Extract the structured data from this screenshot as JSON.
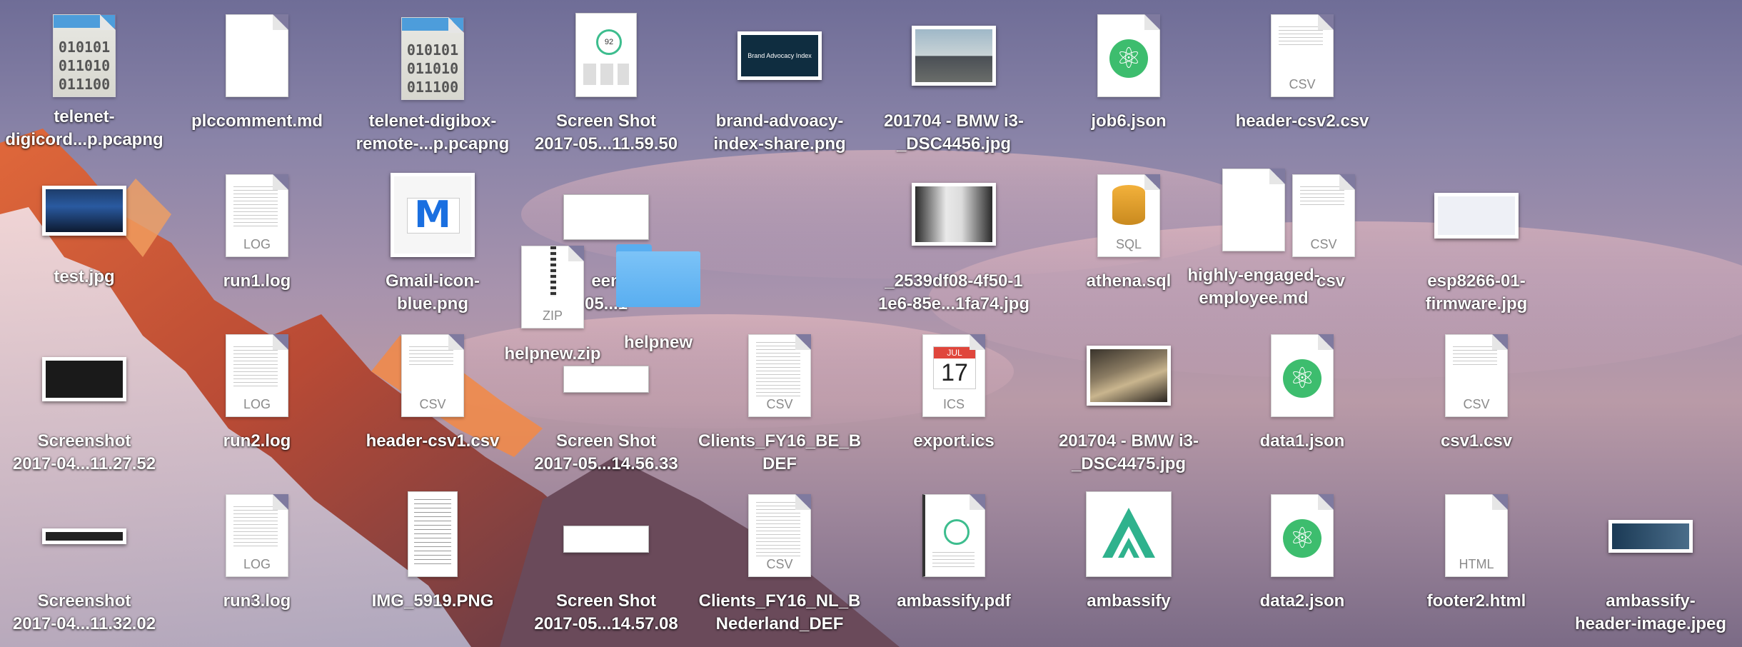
{
  "desktop_icons": [
    {
      "name": "telenet-digicord...p.pcapng",
      "lines": [
        "telenet-",
        "digicord...p.pcapng"
      ],
      "kind": "binary"
    },
    {
      "name": "plccomment.md",
      "lines": [
        "plccomment.md"
      ],
      "kind": "blank"
    },
    {
      "name": "telenet-digibox-remote-...p.pcapng",
      "lines": [
        "telenet-digibox-",
        "remote-...p.pcapng"
      ],
      "kind": "binary"
    },
    {
      "name": "Screen Shot 2017-05...11.59.50",
      "lines": [
        "Screen Shot",
        "2017-05...11.59.50"
      ],
      "kind": "screenshot"
    },
    {
      "name": "brand-advoacy-index-share.png",
      "lines": [
        "brand-advoacy-",
        "index-share.png"
      ],
      "kind": "image",
      "thumb_text": "Brand Advocacy Index"
    },
    {
      "name": "201704 - BMW i3-_DSC4456.jpg",
      "lines": [
        "201704 - BMW i3-",
        "_DSC4456.jpg"
      ],
      "kind": "photo"
    },
    {
      "name": "job6.json",
      "lines": [
        "job6.json"
      ],
      "kind": "json"
    },
    {
      "name": "header-csv2.csv",
      "lines": [
        "header-csv2.csv"
      ],
      "kind": "csv",
      "ext": "CSV"
    },
    {
      "name": "test.jpg",
      "lines": [
        "test.jpg"
      ],
      "kind": "photo"
    },
    {
      "name": "run1.log",
      "lines": [
        "run1.log"
      ],
      "kind": "log",
      "ext": "LOG"
    },
    {
      "name": "Gmail-icon-blue.png",
      "lines": [
        "Gmail-icon-",
        "blue.png"
      ],
      "kind": "gmail"
    },
    {
      "name": "Screen Shot 2017-05...",
      "lines": [
        "een",
        "05...1"
      ],
      "kind": "screenshot"
    },
    {
      "name": "helpnew.zip",
      "lines": [
        "helpnew.zip"
      ],
      "kind": "zip",
      "ext": "ZIP"
    },
    {
      "name": "helpnew",
      "lines": [
        "helpnew"
      ],
      "kind": "folder"
    },
    {
      "name": "_2539df08-4f50-11e6-85e...1fa74.jpg",
      "lines": [
        "_2539df08-4f50-1",
        "1e6-85e...1fa74.jpg"
      ],
      "kind": "photo"
    },
    {
      "name": "athena.sql",
      "lines": [
        "athena.sql"
      ],
      "kind": "sql",
      "ext": "SQL"
    },
    {
      "name": "highly-engaged-employee.md",
      "lines": [
        "highly-engaged-",
        "employee.md"
      ],
      "kind": "blank"
    },
    {
      "name": "e...csv",
      "lines": [
        "csv"
      ],
      "kind": "csv",
      "ext": "CSV"
    },
    {
      "name": "esp8266-01-firmware.jpg",
      "lines": [
        "esp8266-01-",
        "firmware.jpg"
      ],
      "kind": "image"
    },
    {
      "name": "Screenshot 2017-04...11.27.52",
      "lines": [
        "Screenshot",
        "2017-04...11.27.52"
      ],
      "kind": "screenshot"
    },
    {
      "name": "run2.log",
      "lines": [
        "run2.log"
      ],
      "kind": "log",
      "ext": "LOG"
    },
    {
      "name": "header-csv1.csv",
      "lines": [
        "header-csv1.csv"
      ],
      "kind": "csv",
      "ext": "CSV"
    },
    {
      "name": "Screen Shot 2017-05...14.56.33",
      "lines": [
        "Screen Shot",
        "2017-05...14.56.33"
      ],
      "kind": "screenshot"
    },
    {
      "name": "Clients_FY16_BE_BDEF",
      "lines": [
        "Clients_FY16_BE_B",
        "DEF"
      ],
      "kind": "csv",
      "ext": "CSV"
    },
    {
      "name": "export.ics",
      "lines": [
        "export.ics"
      ],
      "kind": "ics",
      "ext": "ICS",
      "month": "JUL",
      "day": "17"
    },
    {
      "name": "201704 - BMW i3-_DSC4475.jpg",
      "lines": [
        "201704 - BMW i3-",
        "_DSC4475.jpg"
      ],
      "kind": "photo"
    },
    {
      "name": "data1.json",
      "lines": [
        "data1.json"
      ],
      "kind": "json"
    },
    {
      "name": "csv1.csv",
      "lines": [
        "csv1.csv"
      ],
      "kind": "csv",
      "ext": "CSV"
    },
    {
      "name": "Screenshot 2017-04...11.32.02",
      "lines": [
        "Screenshot",
        "2017-04...11.32.02"
      ],
      "kind": "screenshot"
    },
    {
      "name": "run3.log",
      "lines": [
        "run3.log"
      ],
      "kind": "log",
      "ext": "LOG"
    },
    {
      "name": "IMG_5919.PNG",
      "lines": [
        "IMG_5919.PNG"
      ],
      "kind": "image"
    },
    {
      "name": "Screen Shot 2017-05...14.57.08",
      "lines": [
        "Screen Shot",
        "2017-05...14.57.08"
      ],
      "kind": "screenshot"
    },
    {
      "name": "Clients_FY16_NL_BNederland_DEF",
      "lines": [
        "Clients_FY16_NL_B",
        "Nederland_DEF"
      ],
      "kind": "csv",
      "ext": "CSV"
    },
    {
      "name": "ambassify.pdf",
      "lines": [
        "ambassify.pdf"
      ],
      "kind": "pdf"
    },
    {
      "name": "ambassify",
      "lines": [
        "ambassify"
      ],
      "kind": "app"
    },
    {
      "name": "data2.json",
      "lines": [
        "data2.json"
      ],
      "kind": "json"
    },
    {
      "name": "footer2.html",
      "lines": [
        "footer2.html"
      ],
      "kind": "html",
      "ext": "HTML"
    },
    {
      "name": "ambassify-header-image.jpeg",
      "lines": [
        "ambassify-",
        "header-image.jpeg"
      ],
      "kind": "image"
    }
  ],
  "colors": {
    "json_green": "#3dbd6e",
    "folder_blue": "#59aef0",
    "gmail_red": "#d93025"
  }
}
